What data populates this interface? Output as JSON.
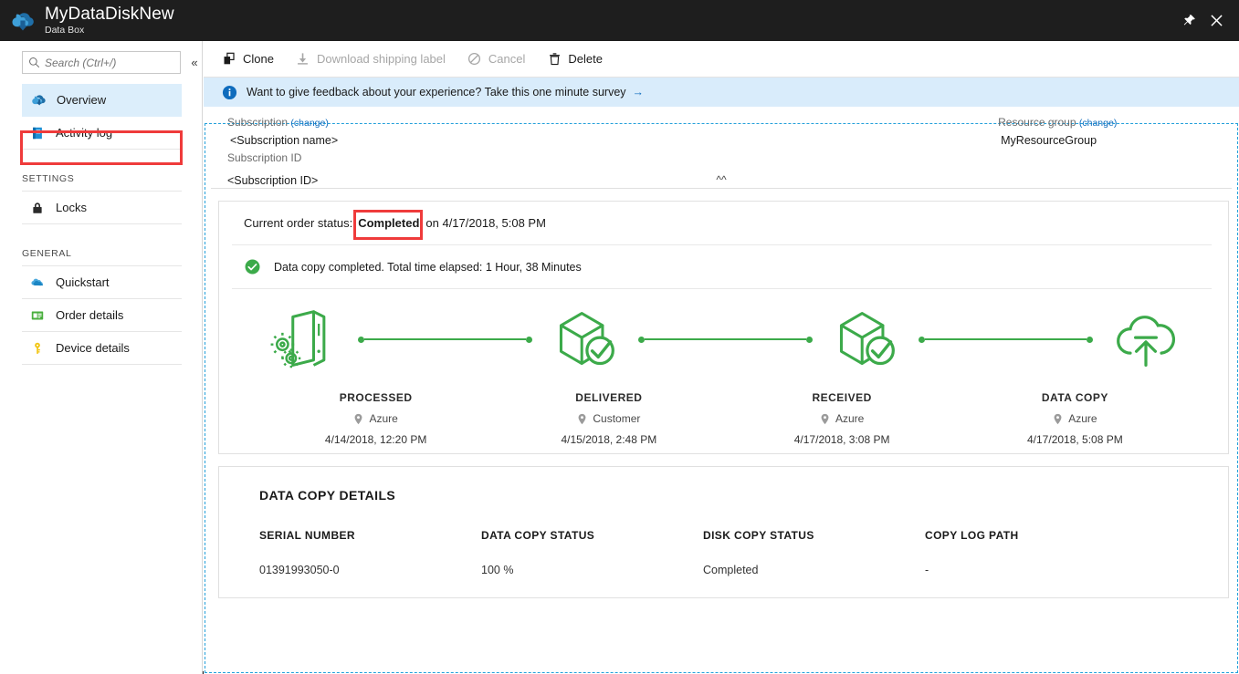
{
  "titlebar": {
    "logo_icon": "azure-databox-cloud-icon",
    "title": "MyDataDiskNew",
    "subtitle": "Data Box",
    "pin_icon": "pin-icon",
    "close_icon": "close-icon"
  },
  "sidebar": {
    "search": {
      "placeholder": "Search (Ctrl+/)",
      "value": "",
      "icon": "search-icon"
    },
    "collapse_icon": "chevron-double-left-icon",
    "items": [
      {
        "label": "Overview",
        "icon": "overview-cloud-icon",
        "selected": true
      },
      {
        "label": "Activity log",
        "icon": "activity-log-icon",
        "selected": false
      }
    ],
    "groups": [
      {
        "title": "SETTINGS",
        "items": [
          {
            "label": "Locks",
            "icon": "lock-icon",
            "selected": false
          }
        ]
      },
      {
        "title": "GENERAL",
        "items": [
          {
            "label": "Quickstart",
            "icon": "quickstart-cloud-icon",
            "selected": false
          },
          {
            "label": "Order details",
            "icon": "order-details-card-icon",
            "selected": false
          },
          {
            "label": "Device details",
            "icon": "key-icon",
            "selected": false
          }
        ]
      }
    ]
  },
  "toolbar": {
    "commands": [
      {
        "label": "Clone",
        "icon": "clone-icon",
        "disabled": false
      },
      {
        "label": "Download shipping label",
        "icon": "download-icon",
        "disabled": true
      },
      {
        "label": "Cancel",
        "icon": "cancel-icon",
        "disabled": true
      },
      {
        "label": "Delete",
        "icon": "trash-icon",
        "disabled": false
      }
    ]
  },
  "infobar": {
    "icon": "info-icon",
    "text": "Want to give feedback about your experience? Take this one minute survey",
    "arrow": "→"
  },
  "essentials": {
    "subscription_label": "Subscription",
    "subscription_change": "(change)",
    "subscription_name": "<Subscription name>",
    "subscription_id_label": "Subscription ID",
    "subscription_id_value": "<Subscription ID>",
    "resource_group_label": "Resource group",
    "resource_group_change": "(change)",
    "resource_group_value": "MyResourceGroup",
    "collapse_chevron": "chevron-double-up-icon"
  },
  "status_card": {
    "status_prefix": "Current order status:",
    "status_value": "Completed",
    "status_suffix": "on 4/17/2018, 5:08 PM",
    "copy_icon": "green-check-circle-icon",
    "copy_message": "Data copy completed. Total time elapsed: 1 Hour, 38 Minutes",
    "highlight_color": "#ef3b3b",
    "accent_color": "#3caa4a"
  },
  "timeline": {
    "stages": [
      {
        "name": "PROCESSED",
        "location": "Azure",
        "date": "4/14/2018, 12:20 PM",
        "icon": "device-gears-icon"
      },
      {
        "name": "DELIVERED",
        "location": "Customer",
        "date": "4/15/2018, 2:48 PM",
        "icon": "box-check-icon"
      },
      {
        "name": "RECEIVED",
        "location": "Azure",
        "date": "4/17/2018, 3:08 PM",
        "icon": "box-check-icon"
      },
      {
        "name": "DATA COPY",
        "location": "Azure",
        "date": "4/17/2018, 5:08 PM",
        "icon": "cloud-upload-icon"
      }
    ],
    "location_icon": "map-pin-icon"
  },
  "details": {
    "title": "DATA COPY DETAILS",
    "columns": [
      {
        "header": "SERIAL NUMBER",
        "value": "01391993050-0"
      },
      {
        "header": "DATA COPY STATUS",
        "value": "100 %"
      },
      {
        "header": "DISK COPY STATUS",
        "value": "Completed"
      },
      {
        "header": "COPY LOG PATH",
        "value": "-"
      }
    ]
  }
}
